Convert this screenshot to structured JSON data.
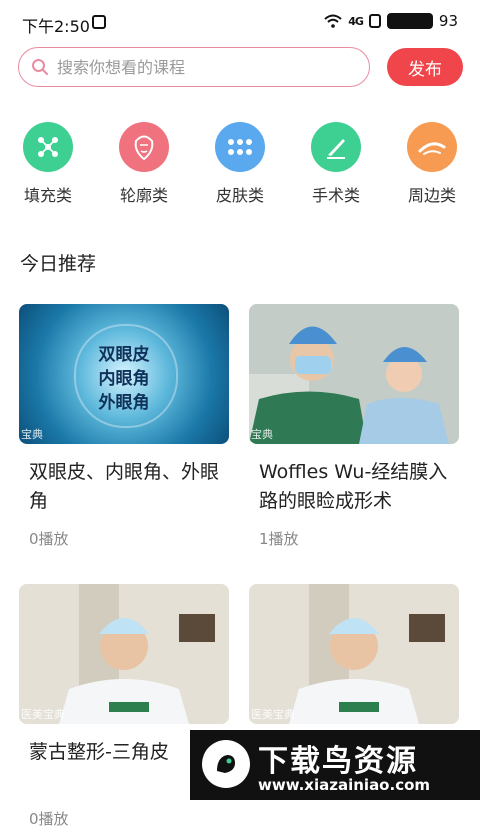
{
  "status_bar": {
    "time": "下午2:50",
    "signal": "4G",
    "battery": "93"
  },
  "search": {
    "placeholder": "搜索你想看的课程"
  },
  "publish_label": "发布",
  "categories": [
    {
      "label": "填充类",
      "icon": "molecule-icon",
      "color": "#3ecf93"
    },
    {
      "label": "轮廓类",
      "icon": "face-outline-icon",
      "color": "#f0727f"
    },
    {
      "label": "皮肤类",
      "icon": "dots-grid-icon",
      "color": "#5aa8ee"
    },
    {
      "label": "手术类",
      "icon": "scalpel-icon",
      "color": "#3ecf93"
    },
    {
      "label": "周边类",
      "icon": "eyebrow-icon",
      "color": "#f79a52"
    }
  ],
  "section_title": "今日推荐",
  "cards": [
    {
      "title": "双眼皮、内眼角、外眼角",
      "plays": "0播放",
      "thumb_text": [
        "双眼皮",
        "内眼角",
        "外眼角"
      ],
      "watermark": "宝典"
    },
    {
      "title": "Woffles Wu-经结膜入路的眼睑成形术",
      "plays": "1播放",
      "watermark": "宝典"
    },
    {
      "title": "蒙古整形-三角皮",
      "plays": "0播放",
      "watermark": "医美宝典"
    },
    {
      "title": "",
      "plays": "",
      "watermark": "医美宝典"
    }
  ],
  "banner": {
    "brand": "下载鸟资源",
    "url": "www.xiazainiao.com"
  }
}
